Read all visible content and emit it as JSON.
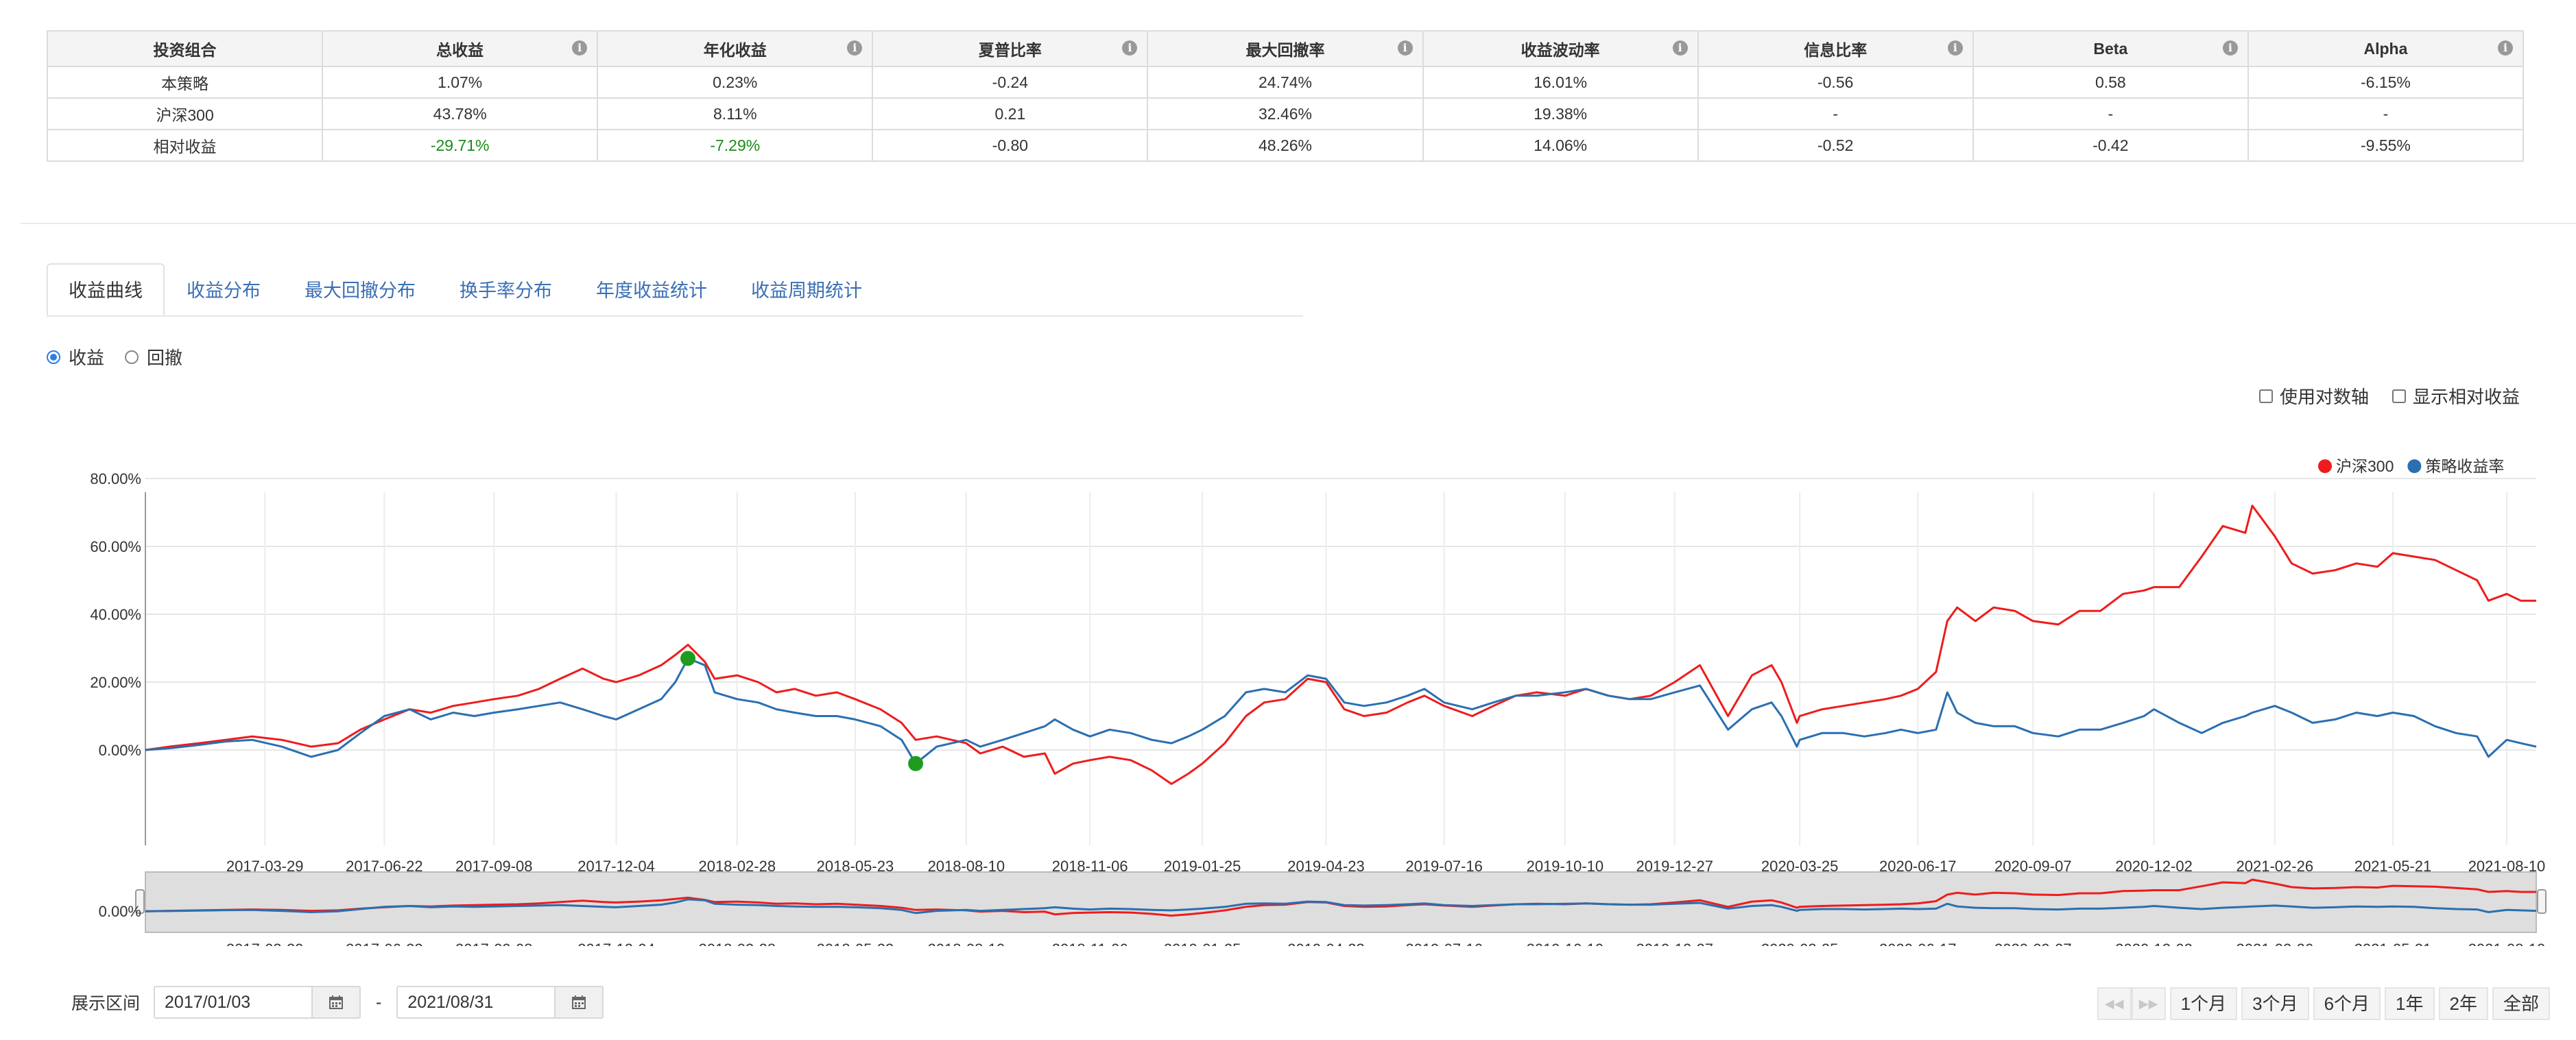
{
  "metrics_table": {
    "headers": [
      "投资组合",
      "总收益",
      "年化收益",
      "夏普比率",
      "最大回撤率",
      "收益波动率",
      "信息比率",
      "Beta",
      "Alpha"
    ],
    "rows": [
      [
        "本策略",
        "1.07%",
        "0.23%",
        "-0.24",
        "24.74%",
        "16.01%",
        "-0.56",
        "0.58",
        "-6.15%"
      ],
      [
        "沪深300",
        "43.78%",
        "8.11%",
        "0.21",
        "32.46%",
        "19.38%",
        "-",
        "-",
        "-"
      ],
      [
        "相对收益",
        "-29.71%",
        "-7.29%",
        "-0.80",
        "48.26%",
        "14.06%",
        "-0.52",
        "-0.42",
        "-9.55%"
      ]
    ],
    "info_icon": "info-icon",
    "negative_color": "#1a8a1a"
  },
  "tabs": [
    {
      "label": "收益曲线",
      "active": true
    },
    {
      "label": "收益分布",
      "active": false
    },
    {
      "label": "最大回撤分布",
      "active": false
    },
    {
      "label": "换手率分布",
      "active": false
    },
    {
      "label": "年度收益统计",
      "active": false
    },
    {
      "label": "收益周期统计",
      "active": false
    }
  ],
  "view_mode": {
    "options": [
      "收益",
      "回撤"
    ],
    "selected": "收益"
  },
  "options": {
    "log_axis_label": "使用对数轴",
    "log_axis_checked": false,
    "show_relative_label": "显示相对收益",
    "show_relative_checked": false
  },
  "colors": {
    "hs300": "#ee1c1c",
    "strategy": "#2a6fb0",
    "marker": "#1f9c1f",
    "accent": "#3a6fb5"
  },
  "chart_data": {
    "type": "line",
    "y_tick_labels": [
      "0.00%",
      "20.00%",
      "40.00%",
      "60.00%",
      "80.00%"
    ],
    "ylim": [
      -20,
      80
    ],
    "x_range": [
      "2017-01-03",
      "2021-08-31"
    ],
    "x_tick_labels": [
      "2017-03-29",
      "2017-06-22",
      "2017-09-08",
      "2017-12-04",
      "2018-02-28",
      "2018-05-23",
      "2018-08-10",
      "2018-11-06",
      "2019-01-25",
      "2019-04-23",
      "2019-07-16",
      "2019-10-10",
      "2019-12-27",
      "2020-03-25",
      "2020-06-17",
      "2020-09-07",
      "2020-12-02",
      "2021-02-26",
      "2021-05-21",
      "2021-08-10"
    ],
    "legend_position": "top-right",
    "grid": true,
    "series": [
      {
        "name": "沪深300",
        "color": "#ee1c1c",
        "points": [
          [
            "2017-01-03",
            0
          ],
          [
            "2017-01-20",
            1
          ],
          [
            "2017-02-10",
            2
          ],
          [
            "2017-03-01",
            3
          ],
          [
            "2017-03-20",
            4
          ],
          [
            "2017-04-10",
            3
          ],
          [
            "2017-05-01",
            1
          ],
          [
            "2017-05-20",
            2
          ],
          [
            "2017-06-05",
            6
          ],
          [
            "2017-06-22",
            9
          ],
          [
            "2017-07-10",
            12
          ],
          [
            "2017-07-25",
            11
          ],
          [
            "2017-08-10",
            13
          ],
          [
            "2017-08-25",
            14
          ],
          [
            "2017-09-08",
            15
          ],
          [
            "2017-09-25",
            16
          ],
          [
            "2017-10-10",
            18
          ],
          [
            "2017-10-25",
            21
          ],
          [
            "2017-11-10",
            24
          ],
          [
            "2017-11-25",
            21
          ],
          [
            "2017-12-04",
            20
          ],
          [
            "2017-12-20",
            22
          ],
          [
            "2018-01-05",
            25
          ],
          [
            "2018-01-15",
            28
          ],
          [
            "2018-01-24",
            31
          ],
          [
            "2018-02-05",
            26
          ],
          [
            "2018-02-12",
            21
          ],
          [
            "2018-02-28",
            22
          ],
          [
            "2018-03-15",
            20
          ],
          [
            "2018-03-28",
            17
          ],
          [
            "2018-04-10",
            18
          ],
          [
            "2018-04-25",
            16
          ],
          [
            "2018-05-10",
            17
          ],
          [
            "2018-05-23",
            15
          ],
          [
            "2018-06-10",
            12
          ],
          [
            "2018-06-25",
            8
          ],
          [
            "2018-07-05",
            3
          ],
          [
            "2018-07-20",
            4
          ],
          [
            "2018-08-10",
            2
          ],
          [
            "2018-08-20",
            -1
          ],
          [
            "2018-09-05",
            1
          ],
          [
            "2018-09-20",
            -2
          ],
          [
            "2018-10-05",
            -1
          ],
          [
            "2018-10-12",
            -7
          ],
          [
            "2018-10-25",
            -4
          ],
          [
            "2018-11-06",
            -3
          ],
          [
            "2018-11-20",
            -2
          ],
          [
            "2018-12-05",
            -3
          ],
          [
            "2018-12-20",
            -6
          ],
          [
            "2019-01-03",
            -10
          ],
          [
            "2019-01-15",
            -7
          ],
          [
            "2019-01-25",
            -4
          ],
          [
            "2019-02-10",
            2
          ],
          [
            "2019-02-25",
            10
          ],
          [
            "2019-03-10",
            14
          ],
          [
            "2019-03-25",
            15
          ],
          [
            "2019-04-10",
            21
          ],
          [
            "2019-04-23",
            20
          ],
          [
            "2019-05-06",
            12
          ],
          [
            "2019-05-20",
            10
          ],
          [
            "2019-06-05",
            11
          ],
          [
            "2019-06-20",
            14
          ],
          [
            "2019-07-02",
            16
          ],
          [
            "2019-07-16",
            13
          ],
          [
            "2019-08-05",
            10
          ],
          [
            "2019-08-20",
            13
          ],
          [
            "2019-09-05",
            16
          ],
          [
            "2019-09-20",
            17
          ],
          [
            "2019-10-10",
            16
          ],
          [
            "2019-10-25",
            18
          ],
          [
            "2019-11-10",
            16
          ],
          [
            "2019-11-25",
            15
          ],
          [
            "2019-12-10",
            16
          ],
          [
            "2019-12-27",
            20
          ],
          [
            "2020-01-14",
            25
          ],
          [
            "2020-02-03",
            10
          ],
          [
            "2020-02-20",
            22
          ],
          [
            "2020-03-05",
            25
          ],
          [
            "2020-03-12",
            20
          ],
          [
            "2020-03-23",
            8
          ],
          [
            "2020-03-25",
            10
          ],
          [
            "2020-04-10",
            12
          ],
          [
            "2020-04-25",
            13
          ],
          [
            "2020-05-10",
            14
          ],
          [
            "2020-05-25",
            15
          ],
          [
            "2020-06-05",
            16
          ],
          [
            "2020-06-17",
            18
          ],
          [
            "2020-06-30",
            23
          ],
          [
            "2020-07-08",
            38
          ],
          [
            "2020-07-15",
            42
          ],
          [
            "2020-07-28",
            38
          ],
          [
            "2020-08-10",
            42
          ],
          [
            "2020-08-25",
            41
          ],
          [
            "2020-09-07",
            38
          ],
          [
            "2020-09-25",
            37
          ],
          [
            "2020-10-10",
            41
          ],
          [
            "2020-10-25",
            41
          ],
          [
            "2020-11-10",
            46
          ],
          [
            "2020-11-25",
            47
          ],
          [
            "2020-12-02",
            48
          ],
          [
            "2020-12-20",
            48
          ],
          [
            "2021-01-05",
            57
          ],
          [
            "2021-01-20",
            66
          ],
          [
            "2021-02-05",
            64
          ],
          [
            "2021-02-10",
            72
          ],
          [
            "2021-02-26",
            63
          ],
          [
            "2021-03-10",
            55
          ],
          [
            "2021-03-25",
            52
          ],
          [
            "2021-04-10",
            53
          ],
          [
            "2021-04-25",
            55
          ],
          [
            "2021-05-10",
            54
          ],
          [
            "2021-05-21",
            58
          ],
          [
            "2021-06-05",
            57
          ],
          [
            "2021-06-20",
            56
          ],
          [
            "2021-07-05",
            53
          ],
          [
            "2021-07-20",
            50
          ],
          [
            "2021-07-28",
            44
          ],
          [
            "2021-08-10",
            46
          ],
          [
            "2021-08-20",
            44
          ],
          [
            "2021-08-31",
            44
          ]
        ]
      },
      {
        "name": "策略收益率",
        "color": "#2a6fb0",
        "points": [
          [
            "2017-01-03",
            0
          ],
          [
            "2017-01-20",
            0.5
          ],
          [
            "2017-02-10",
            1.5
          ],
          [
            "2017-03-01",
            2.5
          ],
          [
            "2017-03-20",
            3
          ],
          [
            "2017-04-10",
            1
          ],
          [
            "2017-05-01",
            -2
          ],
          [
            "2017-05-20",
            0
          ],
          [
            "2017-06-05",
            5
          ],
          [
            "2017-06-22",
            10
          ],
          [
            "2017-07-10",
            12
          ],
          [
            "2017-07-25",
            9
          ],
          [
            "2017-08-10",
            11
          ],
          [
            "2017-08-25",
            10
          ],
          [
            "2017-09-08",
            11
          ],
          [
            "2017-09-25",
            12
          ],
          [
            "2017-10-10",
            13
          ],
          [
            "2017-10-25",
            14
          ],
          [
            "2017-11-10",
            12
          ],
          [
            "2017-11-25",
            10
          ],
          [
            "2017-12-04",
            9
          ],
          [
            "2017-12-20",
            12
          ],
          [
            "2018-01-05",
            15
          ],
          [
            "2018-01-15",
            20
          ],
          [
            "2018-01-24",
            27
          ],
          [
            "2018-02-05",
            25
          ],
          [
            "2018-02-12",
            17
          ],
          [
            "2018-02-28",
            15
          ],
          [
            "2018-03-15",
            14
          ],
          [
            "2018-03-28",
            12
          ],
          [
            "2018-04-10",
            11
          ],
          [
            "2018-04-25",
            10
          ],
          [
            "2018-05-10",
            10
          ],
          [
            "2018-05-23",
            9
          ],
          [
            "2018-06-10",
            7
          ],
          [
            "2018-06-25",
            3
          ],
          [
            "2018-07-05",
            -4
          ],
          [
            "2018-07-20",
            1
          ],
          [
            "2018-08-10",
            3
          ],
          [
            "2018-08-20",
            1
          ],
          [
            "2018-09-05",
            3
          ],
          [
            "2018-09-20",
            5
          ],
          [
            "2018-10-05",
            7
          ],
          [
            "2018-10-12",
            9
          ],
          [
            "2018-10-25",
            6
          ],
          [
            "2018-11-06",
            4
          ],
          [
            "2018-11-20",
            6
          ],
          [
            "2018-12-05",
            5
          ],
          [
            "2018-12-20",
            3
          ],
          [
            "2019-01-03",
            2
          ],
          [
            "2019-01-15",
            4
          ],
          [
            "2019-01-25",
            6
          ],
          [
            "2019-02-10",
            10
          ],
          [
            "2019-02-25",
            17
          ],
          [
            "2019-03-10",
            18
          ],
          [
            "2019-03-25",
            17
          ],
          [
            "2019-04-10",
            22
          ],
          [
            "2019-04-23",
            21
          ],
          [
            "2019-05-06",
            14
          ],
          [
            "2019-05-20",
            13
          ],
          [
            "2019-06-05",
            14
          ],
          [
            "2019-06-20",
            16
          ],
          [
            "2019-07-02",
            18
          ],
          [
            "2019-07-16",
            14
          ],
          [
            "2019-08-05",
            12
          ],
          [
            "2019-08-20",
            14
          ],
          [
            "2019-09-05",
            16
          ],
          [
            "2019-09-20",
            16
          ],
          [
            "2019-10-10",
            17
          ],
          [
            "2019-10-25",
            18
          ],
          [
            "2019-11-10",
            16
          ],
          [
            "2019-11-25",
            15
          ],
          [
            "2019-12-10",
            15
          ],
          [
            "2019-12-27",
            17
          ],
          [
            "2020-01-14",
            19
          ],
          [
            "2020-02-03",
            6
          ],
          [
            "2020-02-20",
            12
          ],
          [
            "2020-03-05",
            14
          ],
          [
            "2020-03-12",
            10
          ],
          [
            "2020-03-23",
            1
          ],
          [
            "2020-03-25",
            3
          ],
          [
            "2020-04-10",
            5
          ],
          [
            "2020-04-25",
            5
          ],
          [
            "2020-05-10",
            4
          ],
          [
            "2020-05-25",
            5
          ],
          [
            "2020-06-05",
            6
          ],
          [
            "2020-06-17",
            5
          ],
          [
            "2020-06-30",
            6
          ],
          [
            "2020-07-08",
            17
          ],
          [
            "2020-07-15",
            11
          ],
          [
            "2020-07-28",
            8
          ],
          [
            "2020-08-10",
            7
          ],
          [
            "2020-08-25",
            7
          ],
          [
            "2020-09-07",
            5
          ],
          [
            "2020-09-25",
            4
          ],
          [
            "2020-10-10",
            6
          ],
          [
            "2020-10-25",
            6
          ],
          [
            "2020-11-10",
            8
          ],
          [
            "2020-11-25",
            10
          ],
          [
            "2020-12-02",
            12
          ],
          [
            "2020-12-20",
            8
          ],
          [
            "2021-01-05",
            5
          ],
          [
            "2021-01-20",
            8
          ],
          [
            "2021-02-05",
            10
          ],
          [
            "2021-02-10",
            11
          ],
          [
            "2021-02-26",
            13
          ],
          [
            "2021-03-10",
            11
          ],
          [
            "2021-03-25",
            8
          ],
          [
            "2021-04-10",
            9
          ],
          [
            "2021-04-25",
            11
          ],
          [
            "2021-05-10",
            10
          ],
          [
            "2021-05-21",
            11
          ],
          [
            "2021-06-05",
            10
          ],
          [
            "2021-06-20",
            7
          ],
          [
            "2021-07-05",
            5
          ],
          [
            "2021-07-20",
            4
          ],
          [
            "2021-07-28",
            -2
          ],
          [
            "2021-08-10",
            3
          ],
          [
            "2021-08-20",
            2
          ],
          [
            "2021-08-31",
            1
          ]
        ]
      }
    ],
    "max_drawdown_markers": [
      [
        "2018-01-24",
        27
      ],
      [
        "2018-07-05",
        -4
      ]
    ],
    "navigator_y_tick_label": "0.00%"
  },
  "range_selector": {
    "label": "展示区间",
    "start": "2017/01/03",
    "separator": "-",
    "end": "2021/08/31",
    "calendar_icon": "calendar-icon",
    "buttons": [
      "1个月",
      "3个月",
      "6个月",
      "1年",
      "2年",
      "全部"
    ]
  }
}
